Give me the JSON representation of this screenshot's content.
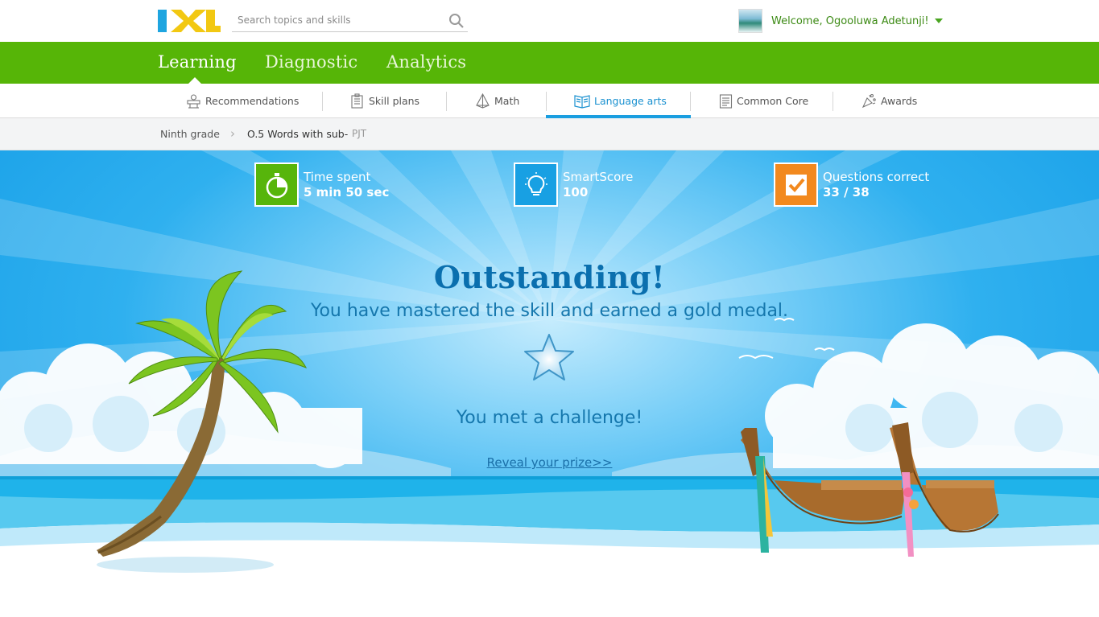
{
  "header": {
    "logo_text": "IXL",
    "search_placeholder": "Search topics and skills",
    "welcome": "Welcome, Ogooluwa Adetunji!"
  },
  "main_nav": {
    "tabs": [
      {
        "label": "Learning",
        "active": true
      },
      {
        "label": "Diagnostic",
        "active": false
      },
      {
        "label": "Analytics",
        "active": false
      }
    ]
  },
  "sub_nav": {
    "items": [
      {
        "label": "Recommendations",
        "icon": "recommendations-icon"
      },
      {
        "label": "Skill plans",
        "icon": "skill-plans-icon"
      },
      {
        "label": "Math",
        "icon": "math-icon"
      },
      {
        "label": "Language arts",
        "icon": "language-arts-icon",
        "active": true
      },
      {
        "label": "Common Core",
        "icon": "common-core-icon"
      },
      {
        "label": "Awards",
        "icon": "awards-icon"
      }
    ]
  },
  "breadcrumb": {
    "grade": "Ninth grade",
    "skill": "O.5 Words with sub-",
    "code": "PJT"
  },
  "stats": [
    {
      "label": "Time spent",
      "value": "5 min 50 sec",
      "icon": "stopwatch-icon",
      "color": "#57b50b"
    },
    {
      "label": "SmartScore",
      "value": "100",
      "icon": "lightbulb-icon",
      "color": "#18a0e3"
    },
    {
      "label": "Questions correct",
      "value": "33 / 38",
      "icon": "checkmark-icon",
      "color": "#f2891e"
    }
  ],
  "result": {
    "headline": "Outstanding!",
    "message": "You have mastered the skill and earned a gold medal.",
    "challenge": "You met a challenge!",
    "prize_link": "Reveal your prize>>"
  },
  "colors": {
    "brand_green": "#56b507",
    "accent_blue": "#1a9ee0"
  }
}
